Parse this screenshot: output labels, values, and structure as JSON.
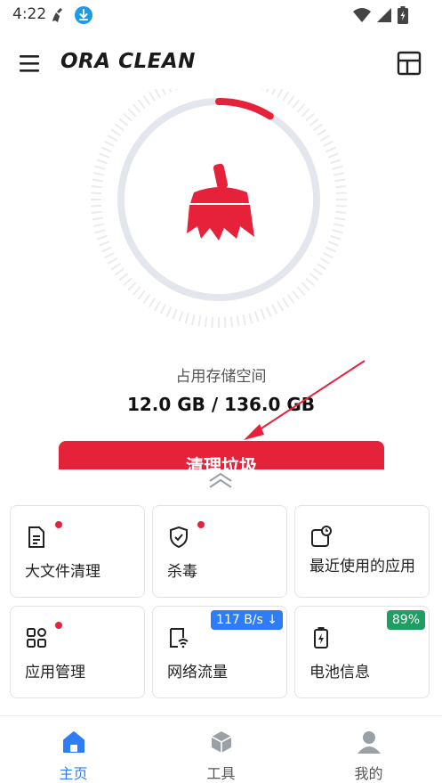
{
  "status_bar": {
    "time": "4:22",
    "icons": [
      "broom-icon",
      "download-icon",
      "wifi-icon",
      "signal-icon",
      "battery-charging-icon"
    ]
  },
  "header": {
    "logo_text": "ORA CLEAN",
    "menu_icon": "hamburger-menu-icon",
    "layout_icon": "layout-icon"
  },
  "storage": {
    "label": "占用存储空间",
    "value": "12.0 GB / 136.0 GB",
    "used_fraction": 0.088,
    "center_icon": "broom-icon",
    "accent_color": "#e6223a"
  },
  "clean_button": {
    "label": "清理垃圾"
  },
  "tools": [
    {
      "label": "大文件清理",
      "icon": "file-document-icon",
      "dot": true
    },
    {
      "label": "杀毒",
      "icon": "shield-check-icon",
      "dot": true
    },
    {
      "label": "最近使用的应用",
      "icon": "recent-apps-icon",
      "dot": false
    },
    {
      "label": "应用管理",
      "icon": "app-grid-icon",
      "dot": true
    },
    {
      "label": "网络流量",
      "icon": "network-traffic-icon",
      "dot": false,
      "badge": "117 B/s ↓",
      "badge_color": "#2e7cf6"
    },
    {
      "label": "电池信息",
      "icon": "battery-icon",
      "dot": false,
      "badge": "89%",
      "badge_color": "#1e9e63"
    }
  ],
  "bottom_nav": [
    {
      "label": "主页",
      "icon": "home-icon",
      "active": true,
      "color": "#2e7cf6"
    },
    {
      "label": "工具",
      "icon": "toolbox-cube-icon",
      "active": false,
      "color": "#555555"
    },
    {
      "label": "我的",
      "icon": "person-icon",
      "active": false,
      "color": "#555555"
    }
  ]
}
